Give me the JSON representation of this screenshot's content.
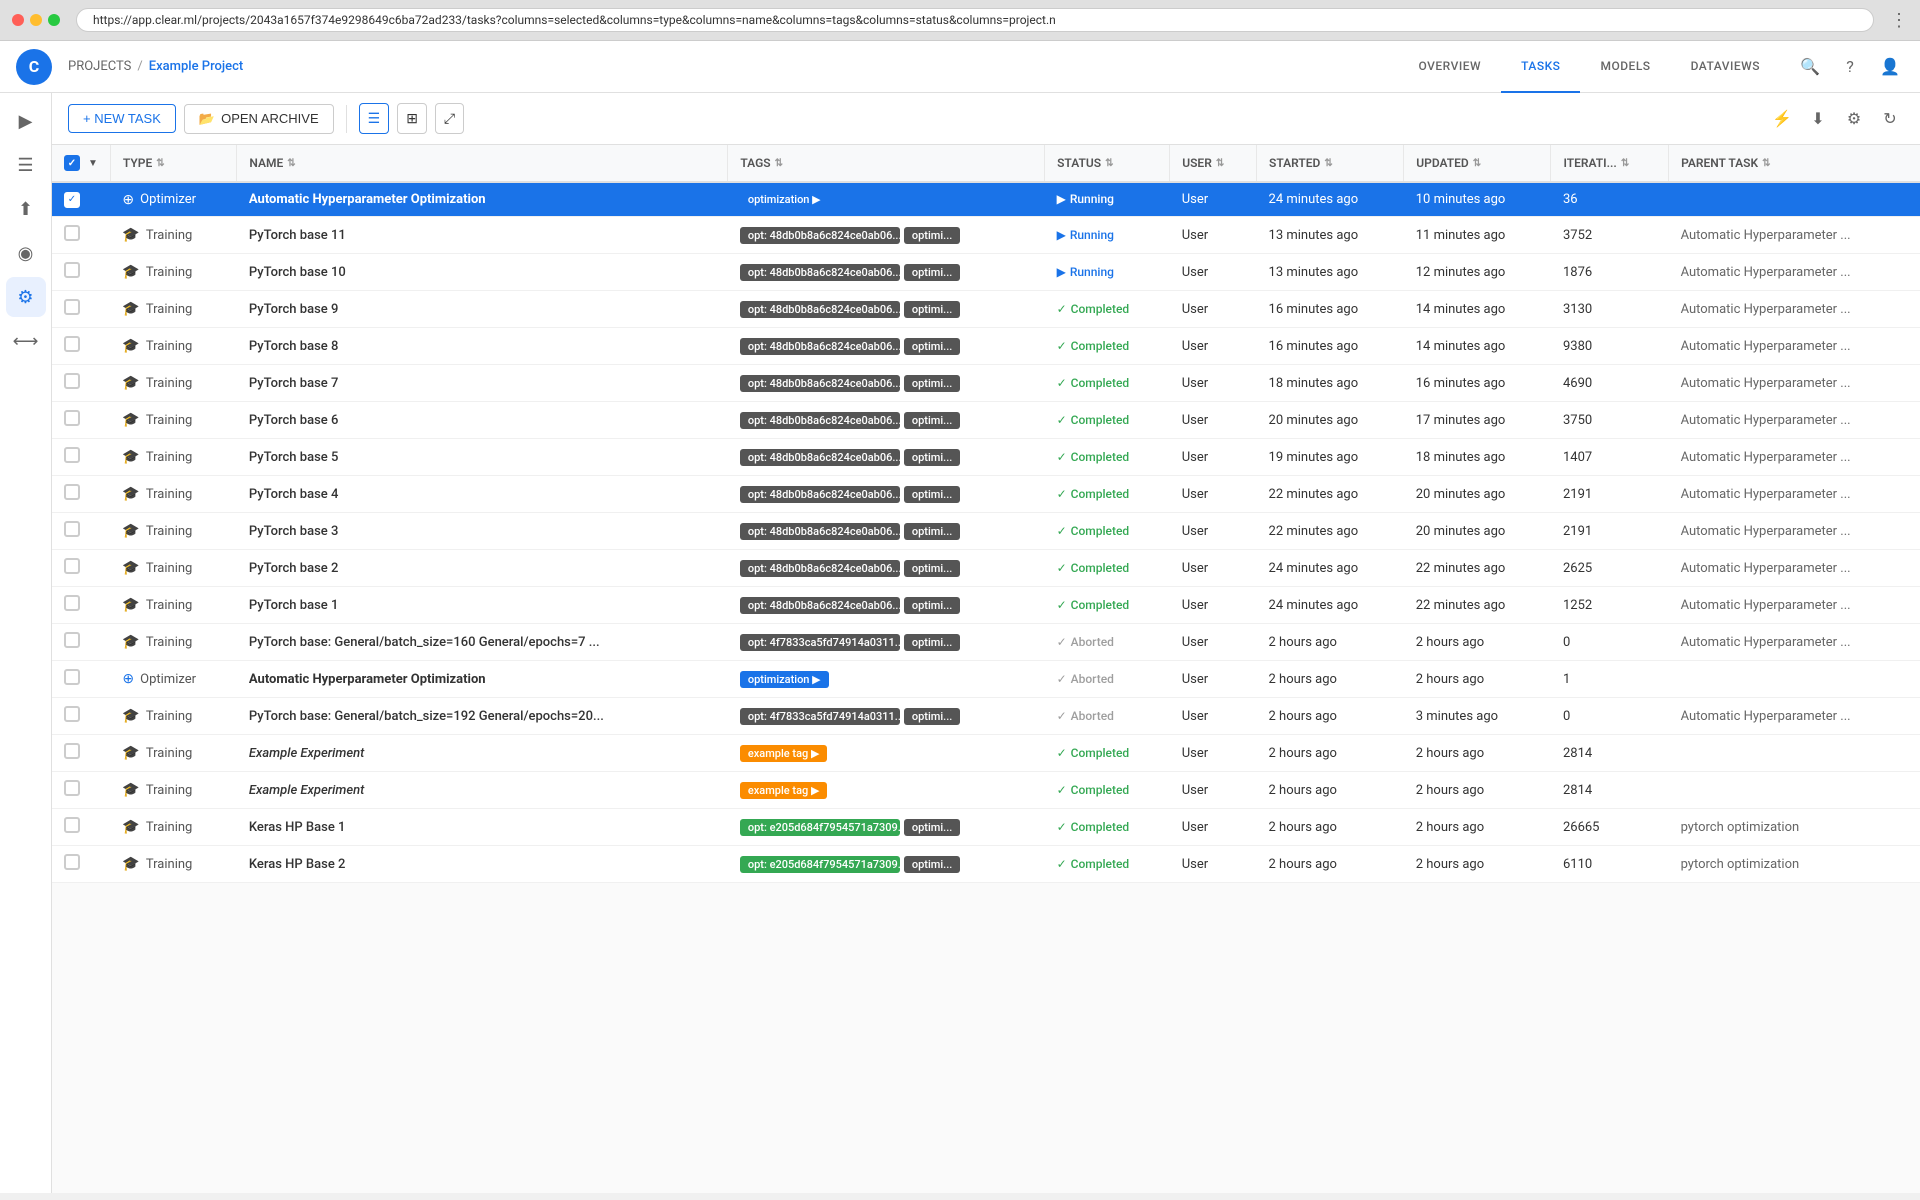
{
  "browser": {
    "url": "https://app.clear.ml/projects/2043a1657f374e9298649c6ba72ad233/tasks?columns=selected&columns=type&columns=name&columns=tags&columns=status&columns=project.n",
    "menu_icon": "⋮"
  },
  "app": {
    "logo": "C",
    "breadcrumb": {
      "projects": "PROJECTS",
      "sep": "/",
      "current": "Example Project"
    },
    "nav_tabs": [
      {
        "label": "OVERVIEW",
        "active": false
      },
      {
        "label": "TASKS",
        "active": true
      },
      {
        "label": "MODELS",
        "active": false
      },
      {
        "label": "DATAVIEWS",
        "active": false
      }
    ],
    "toolbar": {
      "new_task": "+ NEW TASK",
      "open_archive": "OPEN ARCHIVE",
      "view_list": "☰",
      "view_grid": "⊞",
      "view_chart": "⤢"
    },
    "table": {
      "columns": [
        {
          "key": "select",
          "label": ""
        },
        {
          "key": "type",
          "label": "TYPE"
        },
        {
          "key": "name",
          "label": "NAME"
        },
        {
          "key": "tags",
          "label": "TAGS"
        },
        {
          "key": "status",
          "label": "STATUS"
        },
        {
          "key": "user",
          "label": "USER"
        },
        {
          "key": "started",
          "label": "STARTED"
        },
        {
          "key": "updated",
          "label": "UPDATED"
        },
        {
          "key": "iterations",
          "label": "ITERATI..."
        },
        {
          "key": "parent_task",
          "label": "PARENT TASK"
        }
      ],
      "rows": [
        {
          "selected": true,
          "type": "Optimizer",
          "type_icon": "optimizer",
          "name": "Automatic Hyperparameter Optimization",
          "name_style": "bold",
          "tags": [
            {
              "text": "optimization",
              "color": "blue",
              "arrow": true
            }
          ],
          "status": "Running",
          "status_type": "running",
          "user": "User",
          "started": "24 minutes ago",
          "updated": "10 minutes ago",
          "iterations": "36",
          "parent_task": ""
        },
        {
          "selected": false,
          "type": "Training",
          "type_icon": "training",
          "name": "PyTorch base 11",
          "name_style": "normal",
          "tags": [
            {
              "text": "opt: 48db0b8a6c824ce0ab06...",
              "color": "dark",
              "arrow": true
            },
            {
              "text": "optimi...",
              "color": "dark",
              "arrow": false
            }
          ],
          "status": "Running",
          "status_type": "running",
          "user": "User",
          "started": "13 minutes ago",
          "updated": "11 minutes ago",
          "iterations": "3752",
          "parent_task": "Automatic Hyperparameter ..."
        },
        {
          "selected": false,
          "type": "Training",
          "type_icon": "training",
          "name": "PyTorch base 10",
          "name_style": "normal",
          "tags": [
            {
              "text": "opt: 48db0b8a6c824ce0ab06...",
              "color": "dark",
              "arrow": true
            },
            {
              "text": "optimi...",
              "color": "dark",
              "arrow": false
            }
          ],
          "status": "Running",
          "status_type": "running",
          "user": "User",
          "started": "13 minutes ago",
          "updated": "12 minutes ago",
          "iterations": "1876",
          "parent_task": "Automatic Hyperparameter ..."
        },
        {
          "selected": false,
          "type": "Training",
          "type_icon": "training",
          "name": "PyTorch base 9",
          "name_style": "normal",
          "tags": [
            {
              "text": "opt: 48db0b8a6c824ce0ab06...",
              "color": "dark",
              "arrow": true
            },
            {
              "text": "optimi...",
              "color": "dark",
              "arrow": false
            }
          ],
          "status": "Completed",
          "status_type": "completed",
          "user": "User",
          "started": "16 minutes ago",
          "updated": "14 minutes ago",
          "iterations": "3130",
          "parent_task": "Automatic Hyperparameter ..."
        },
        {
          "selected": false,
          "type": "Training",
          "type_icon": "training",
          "name": "PyTorch base 8",
          "name_style": "normal",
          "tags": [
            {
              "text": "opt: 48db0b8a6c824ce0ab06...",
              "color": "dark",
              "arrow": true
            },
            {
              "text": "optimi...",
              "color": "dark",
              "arrow": false
            }
          ],
          "status": "Completed",
          "status_type": "completed",
          "user": "User",
          "started": "16 minutes ago",
          "updated": "14 minutes ago",
          "iterations": "9380",
          "parent_task": "Automatic Hyperparameter ..."
        },
        {
          "selected": false,
          "type": "Training",
          "type_icon": "training",
          "name": "PyTorch base 7",
          "name_style": "normal",
          "tags": [
            {
              "text": "opt: 48db0b8a6c824ce0ab06...",
              "color": "dark",
              "arrow": true
            },
            {
              "text": "optimi...",
              "color": "dark",
              "arrow": false
            }
          ],
          "status": "Completed",
          "status_type": "completed",
          "user": "User",
          "started": "18 minutes ago",
          "updated": "16 minutes ago",
          "iterations": "4690",
          "parent_task": "Automatic Hyperparameter ..."
        },
        {
          "selected": false,
          "type": "Training",
          "type_icon": "training",
          "name": "PyTorch base 6",
          "name_style": "normal",
          "tags": [
            {
              "text": "opt: 48db0b8a6c824ce0ab06...",
              "color": "dark",
              "arrow": true
            },
            {
              "text": "optimi...",
              "color": "dark",
              "arrow": false
            }
          ],
          "status": "Completed",
          "status_type": "completed",
          "user": "User",
          "started": "20 minutes ago",
          "updated": "17 minutes ago",
          "iterations": "3750",
          "parent_task": "Automatic Hyperparameter ..."
        },
        {
          "selected": false,
          "type": "Training",
          "type_icon": "training",
          "name": "PyTorch base 5",
          "name_style": "normal",
          "tags": [
            {
              "text": "opt: 48db0b8a6c824ce0ab06...",
              "color": "dark",
              "arrow": true
            },
            {
              "text": "optimi...",
              "color": "dark",
              "arrow": false
            }
          ],
          "status": "Completed",
          "status_type": "completed",
          "user": "User",
          "started": "19 minutes ago",
          "updated": "18 minutes ago",
          "iterations": "1407",
          "parent_task": "Automatic Hyperparameter ..."
        },
        {
          "selected": false,
          "type": "Training",
          "type_icon": "training",
          "name": "PyTorch base 4",
          "name_style": "normal",
          "tags": [
            {
              "text": "opt: 48db0b8a6c824ce0ab06...",
              "color": "dark",
              "arrow": true
            },
            {
              "text": "optimi...",
              "color": "dark",
              "arrow": false
            }
          ],
          "status": "Completed",
          "status_type": "completed",
          "user": "User",
          "started": "22 minutes ago",
          "updated": "20 minutes ago",
          "iterations": "2191",
          "parent_task": "Automatic Hyperparameter ..."
        },
        {
          "selected": false,
          "type": "Training",
          "type_icon": "training",
          "name": "PyTorch base 3",
          "name_style": "normal",
          "tags": [
            {
              "text": "opt: 48db0b8a6c824ce0ab06...",
              "color": "dark",
              "arrow": true
            },
            {
              "text": "optimi...",
              "color": "dark",
              "arrow": false
            }
          ],
          "status": "Completed",
          "status_type": "completed",
          "user": "User",
          "started": "22 minutes ago",
          "updated": "20 minutes ago",
          "iterations": "2191",
          "parent_task": "Automatic Hyperparameter ..."
        },
        {
          "selected": false,
          "type": "Training",
          "type_icon": "training",
          "name": "PyTorch base 2",
          "name_style": "normal",
          "tags": [
            {
              "text": "opt: 48db0b8a6c824ce0ab06...",
              "color": "dark",
              "arrow": true
            },
            {
              "text": "optimi...",
              "color": "dark",
              "arrow": false
            }
          ],
          "status": "Completed",
          "status_type": "completed",
          "user": "User",
          "started": "24 minutes ago",
          "updated": "22 minutes ago",
          "iterations": "2625",
          "parent_task": "Automatic Hyperparameter ..."
        },
        {
          "selected": false,
          "type": "Training",
          "type_icon": "training",
          "name": "PyTorch base 1",
          "name_style": "normal",
          "tags": [
            {
              "text": "opt: 48db0b8a6c824ce0ab06...",
              "color": "dark",
              "arrow": true
            },
            {
              "text": "optimi...",
              "color": "dark",
              "arrow": false
            }
          ],
          "status": "Completed",
          "status_type": "completed",
          "user": "User",
          "started": "24 minutes ago",
          "updated": "22 minutes ago",
          "iterations": "1252",
          "parent_task": "Automatic Hyperparameter ..."
        },
        {
          "selected": false,
          "type": "Training",
          "type_icon": "training",
          "name": "PyTorch base: General/batch_size=160 General/epochs=7 ...",
          "name_style": "normal",
          "tags": [
            {
              "text": "opt: 4f7833ca5fd74914a0311...",
              "color": "dark",
              "arrow": true
            },
            {
              "text": "optimi...",
              "color": "dark",
              "arrow": false
            }
          ],
          "status": "Aborted",
          "status_type": "aborted",
          "user": "User",
          "started": "2 hours ago",
          "updated": "2 hours ago",
          "iterations": "0",
          "parent_task": "Automatic Hyperparameter ..."
        },
        {
          "selected": false,
          "type": "Optimizer",
          "type_icon": "optimizer",
          "name": "Automatic Hyperparameter Optimization",
          "name_style": "bold",
          "tags": [
            {
              "text": "optimization",
              "color": "blue",
              "arrow": true
            }
          ],
          "status": "Aborted",
          "status_type": "aborted",
          "user": "User",
          "started": "2 hours ago",
          "updated": "2 hours ago",
          "iterations": "1",
          "parent_task": ""
        },
        {
          "selected": false,
          "type": "Training",
          "type_icon": "training",
          "name": "PyTorch base: General/batch_size=192 General/epochs=20...",
          "name_style": "normal",
          "tags": [
            {
              "text": "opt: 4f7833ca5fd74914a0311...",
              "color": "dark",
              "arrow": true
            },
            {
              "text": "optimi...",
              "color": "dark",
              "arrow": false
            }
          ],
          "status": "Aborted",
          "status_type": "aborted",
          "user": "User",
          "started": "2 hours ago",
          "updated": "3 minutes ago",
          "iterations": "0",
          "parent_task": "Automatic Hyperparameter ..."
        },
        {
          "selected": false,
          "type": "Training",
          "type_icon": "training",
          "name": "Example Experiment",
          "name_style": "italic",
          "tags": [
            {
              "text": "example tag",
              "color": "orange",
              "arrow": true
            }
          ],
          "status": "Completed",
          "status_type": "completed",
          "user": "User",
          "started": "2 hours ago",
          "updated": "2 hours ago",
          "iterations": "2814",
          "parent_task": ""
        },
        {
          "selected": false,
          "type": "Training",
          "type_icon": "training",
          "name": "Example Experiment",
          "name_style": "italic",
          "tags": [
            {
              "text": "example tag",
              "color": "orange",
              "arrow": true
            }
          ],
          "status": "Completed",
          "status_type": "completed",
          "user": "User",
          "started": "2 hours ago",
          "updated": "2 hours ago",
          "iterations": "2814",
          "parent_task": ""
        },
        {
          "selected": false,
          "type": "Training",
          "type_icon": "training",
          "name": "Keras HP Base 1",
          "name_style": "normal",
          "tags": [
            {
              "text": "opt: e205d684f7954571a7309...",
              "color": "green",
              "arrow": true
            },
            {
              "text": "optimi...",
              "color": "dark",
              "arrow": false
            }
          ],
          "status": "Completed",
          "status_type": "completed",
          "user": "User",
          "started": "2 hours ago",
          "updated": "2 hours ago",
          "iterations": "26665",
          "parent_task": "pytorch optimization"
        },
        {
          "selected": false,
          "type": "Training",
          "type_icon": "training",
          "name": "Keras HP Base 2",
          "name_style": "normal",
          "tags": [
            {
              "text": "opt: e205d684f7954571a7309...",
              "color": "green",
              "arrow": true
            },
            {
              "text": "optimi...",
              "color": "dark",
              "arrow": false
            }
          ],
          "status": "Completed",
          "status_type": "completed",
          "user": "User",
          "started": "2 hours ago",
          "updated": "2 hours ago",
          "iterations": "6110",
          "parent_task": "pytorch optimization"
        }
      ]
    }
  },
  "sidebar": {
    "items": [
      {
        "icon": "▶",
        "name": "pipeline"
      },
      {
        "icon": "☰",
        "name": "tasks"
      },
      {
        "icon": "⬆",
        "name": "datasets"
      },
      {
        "icon": "◉",
        "name": "models"
      },
      {
        "icon": "⚙",
        "name": "settings"
      },
      {
        "icon": "⟷",
        "name": "pipelines2"
      }
    ]
  }
}
